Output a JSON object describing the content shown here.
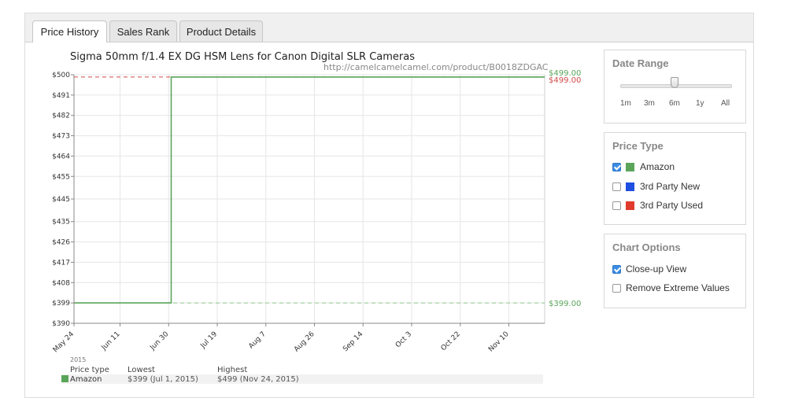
{
  "tabs": [
    {
      "label": "Price History",
      "active": true
    },
    {
      "label": "Sales Rank",
      "active": false
    },
    {
      "label": "Product Details",
      "active": false
    }
  ],
  "chart_data": {
    "type": "line",
    "title": "Sigma 50mm f/1.4 EX DG HSM Lens for Canon Digital SLR Cameras",
    "subtitle": "http://camelcamelcamel.com/product/B0018ZDGAC",
    "y_ticks": [
      "$500",
      "$491",
      "$482",
      "$473",
      "$464",
      "$455",
      "$445",
      "$435",
      "$426",
      "$417",
      "$408",
      "$399",
      "$390"
    ],
    "ylim": [
      390,
      500
    ],
    "x_ticks": [
      "May 24",
      "Jun 11",
      "Jun 30",
      "Jul 19",
      "Aug 7",
      "Aug 26",
      "Sep 14",
      "Oct 3",
      "Oct 22",
      "Nov 10"
    ],
    "x_year_label": "2015",
    "series": [
      {
        "name": "Amazon",
        "color": "#5aa55a",
        "points": [
          [
            "May 24",
            399
          ],
          [
            "Jul 1",
            399
          ],
          [
            "Jul 1",
            499
          ],
          [
            "Nov 24",
            499
          ]
        ]
      }
    ],
    "reference_lines": [
      {
        "value": 499,
        "label": "$499.00",
        "color": "#d04a4a",
        "style": "dashed"
      },
      {
        "value": 399,
        "label": "$399.00",
        "color": "#8fc98f",
        "style": "dashed"
      }
    ],
    "end_labels": [
      {
        "label": "$499.00",
        "color": "#5aa55a"
      },
      {
        "label": "$499.00",
        "color": "#d04a4a"
      },
      {
        "label": "$399.00",
        "color": "#5aa55a"
      }
    ],
    "summary": {
      "headers": [
        "Price type",
        "Lowest",
        "Highest"
      ],
      "rows": [
        {
          "type": "Amazon",
          "color": "#5aa55a",
          "lowest": "$399 (Jul 1, 2015)",
          "highest": "$499 (Nov 24, 2015)"
        }
      ]
    }
  },
  "date_range": {
    "title": "Date Range",
    "options": [
      "1m",
      "3m",
      "6m",
      "1y",
      "All"
    ],
    "selected": "6m"
  },
  "price_type": {
    "title": "Price Type",
    "options": [
      {
        "label": "Amazon",
        "checked": true,
        "color": "#5aa55a"
      },
      {
        "label": "3rd Party New",
        "checked": false,
        "color": "#1f4fe0"
      },
      {
        "label": "3rd Party Used",
        "checked": false,
        "color": "#e03a2c"
      }
    ]
  },
  "chart_options": {
    "title": "Chart Options",
    "options": [
      {
        "label": "Close-up View",
        "checked": true
      },
      {
        "label": "Remove Extreme Values",
        "checked": false
      }
    ]
  }
}
